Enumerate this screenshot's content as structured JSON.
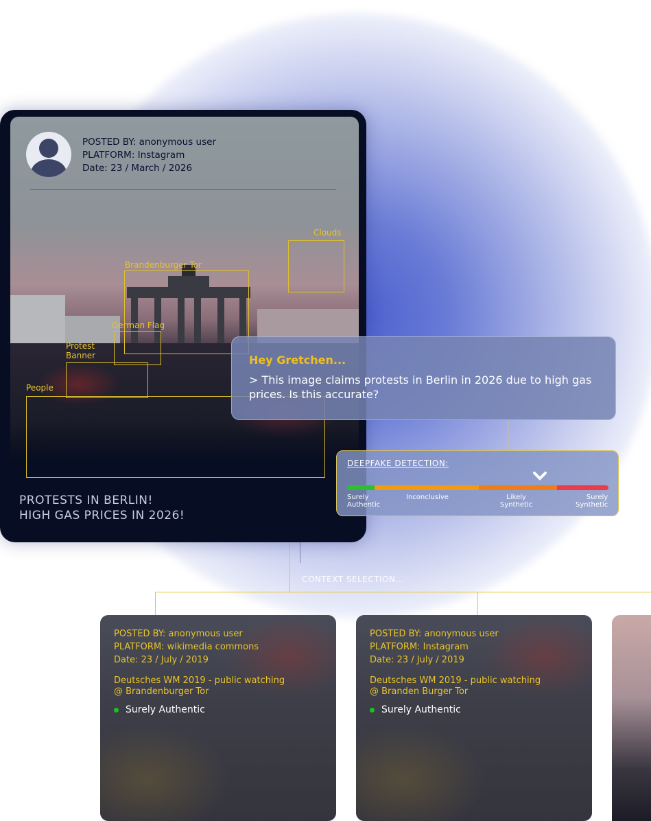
{
  "post": {
    "posted_by": "POSTED BY: anonymous user",
    "platform": "PLATFORM: Instagram",
    "date": "Date: 23 / March / 2026",
    "detections": {
      "clouds": "Clouds",
      "brandenburger": "Brandenburger Tor",
      "german_flag": "German Flag",
      "protest_banner_1": "Protest",
      "protest_banner_2": "Banner",
      "people": "People"
    },
    "headline_1": "PROTESTS IN BERLIN!",
    "headline_2": "HIGH GAS PRICES IN 2026!"
  },
  "chat": {
    "greeting": "Hey Gretchen...",
    "message": "> This image claims protests in Berlin in 2026 due to high gas prices. Is this accurate?"
  },
  "deepfake": {
    "title": "DEEPFAKE DETECTION:",
    "scale": {
      "surely_authentic_1": "Surely",
      "surely_authentic_2": "Authentic",
      "inconclusive": "Inconclusive",
      "likely_synthetic_1": "Likely",
      "likely_synthetic_2": "Synthetic",
      "surely_synthetic_1": "Surely",
      "surely_synthetic_2": "Synthetic"
    },
    "colors": {
      "green": "#2bc12e",
      "orange": "#f29a10",
      "dark_orange": "#f07d18",
      "red": "#ee3b4c"
    }
  },
  "context": {
    "label": "CONTEXT SELECTION...",
    "cards": [
      {
        "posted_by": "POSTED BY: anonymous user",
        "platform": "PLATFORM: wikimedia commons",
        "date": "Date: 23 / July / 2019",
        "desc_1": "Deutsches WM 2019 - public watching",
        "desc_2": "@ Brandenburger Tor",
        "status": "Surely Authentic"
      },
      {
        "posted_by": "POSTED BY: anonymous user",
        "platform": "PLATFORM: Instagram",
        "date": "Date: 23 / July / 2019",
        "desc_1": "Deutsches WM 2019 - public watching",
        "desc_2": "@ Branden Burger Tor",
        "status": "Surely Authentic"
      }
    ]
  }
}
